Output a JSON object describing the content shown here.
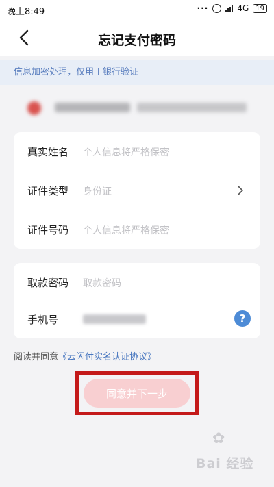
{
  "status_bar": {
    "time": "晚上8:49",
    "dots": "···",
    "network": "4G",
    "battery": "19"
  },
  "nav": {
    "title": "忘记支付密码",
    "back_icon": "chevron-left-icon"
  },
  "info_banner": {
    "text": "信息加密处理，仅用于银行验证"
  },
  "form_card_1": {
    "rows": [
      {
        "label": "真实姓名",
        "placeholder": "个人信息将严格保密"
      },
      {
        "label": "证件类型",
        "value": "身份证"
      },
      {
        "label": "证件号码",
        "placeholder": "个人信息将严格保密"
      }
    ]
  },
  "form_card_2": {
    "rows": [
      {
        "label": "取款密码",
        "placeholder": "取款密码"
      },
      {
        "label": "手机号"
      }
    ],
    "help_icon": "?"
  },
  "agreement": {
    "prefix": "阅读并同意",
    "link": "《云闪付实名认证协议》"
  },
  "submit": {
    "label": "同意并下一步"
  },
  "watermark": {
    "text": "Bai 经验"
  },
  "colors": {
    "accent_blue": "#4a78c0",
    "banner_bg": "#e8eef7",
    "button_disabled": "#f8cfd1",
    "highlight_red": "#c41a1a"
  }
}
